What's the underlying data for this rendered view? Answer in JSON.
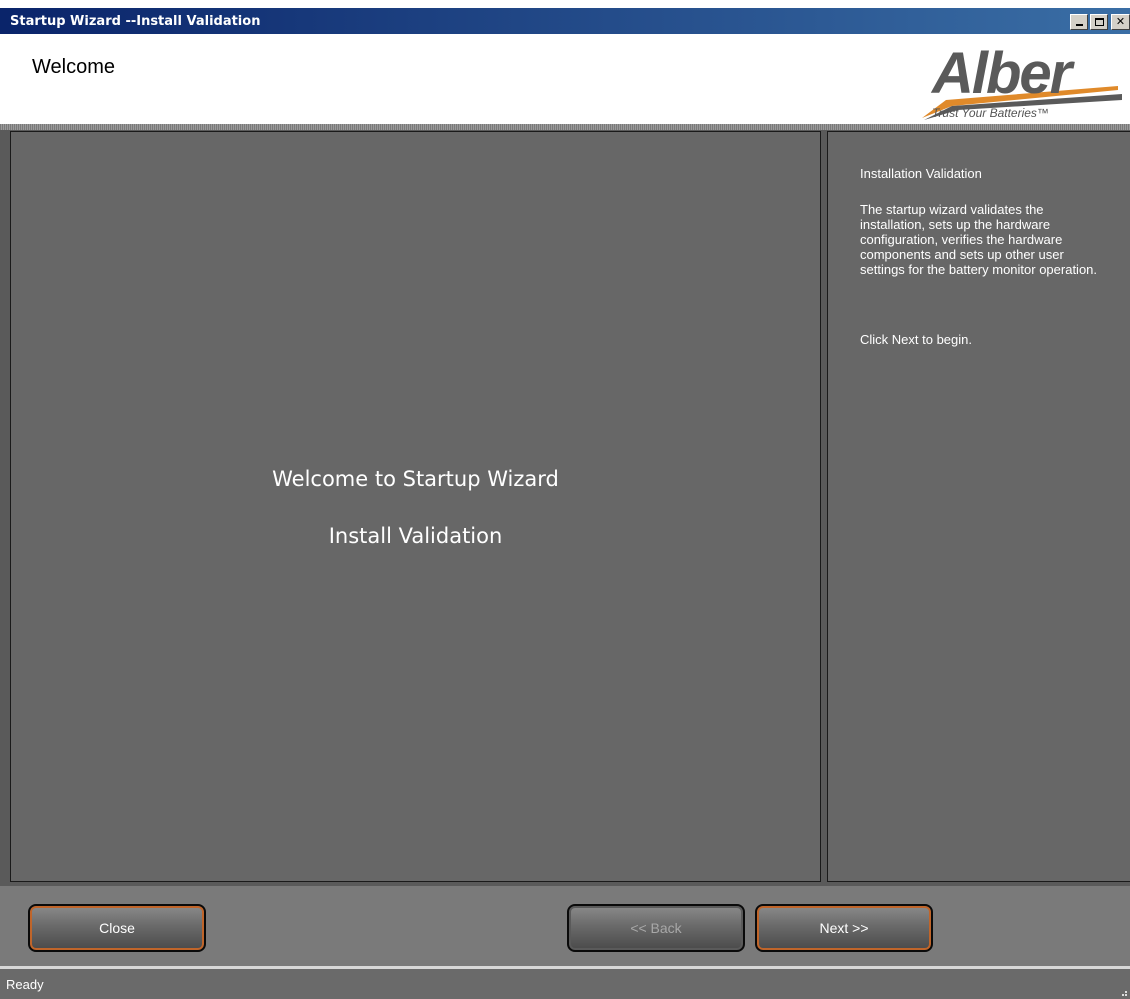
{
  "window": {
    "title": "Startup Wizard --Install Validation",
    "controls": {
      "minimize_icon": "minimize-icon",
      "maximize_icon": "maximize-icon",
      "close_icon": "close-icon"
    }
  },
  "header": {
    "title": "Welcome",
    "logo": {
      "text": "Alber",
      "tagline": "Trust Your Batteries™"
    }
  },
  "main": {
    "title": "Welcome to Startup Wizard",
    "subtitle": "Install Validation"
  },
  "side": {
    "heading": "Installation Validation",
    "body": "The startup wizard validates the installation, sets up the hardware configuration, verifies the hardware components and sets up other user settings for the battery monitor operation.",
    "footer": "Click Next to begin."
  },
  "buttons": {
    "close": "Close",
    "back": "<< Back",
    "next": "Next >>"
  },
  "status": {
    "text": "Ready"
  },
  "colors": {
    "accent": "#c0652a",
    "panel": "#676767",
    "title_bar": "#0a246a"
  }
}
